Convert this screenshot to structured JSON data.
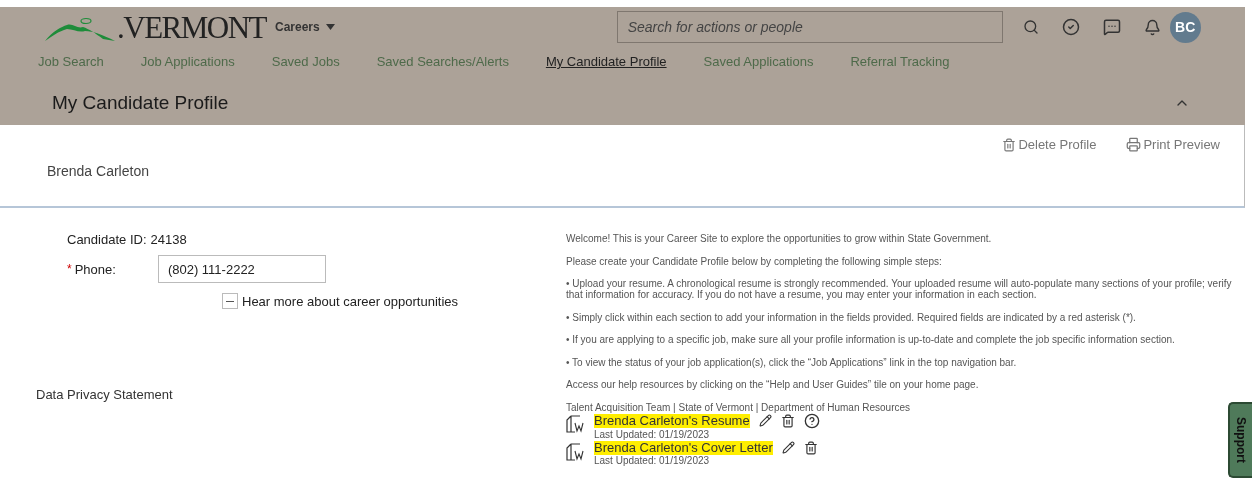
{
  "header": {
    "logo_text": ".VERMONT",
    "menu": "Careers",
    "search": {
      "placeholder": "Search for actions or people"
    },
    "avatar": "BC"
  },
  "nav": [
    {
      "label": "Job Search",
      "selected": false
    },
    {
      "label": "Job Applications",
      "selected": false
    },
    {
      "label": "Saved Jobs",
      "selected": false
    },
    {
      "label": "Saved Searches/Alerts",
      "selected": false
    },
    {
      "label": "My Candidate Profile",
      "selected": true
    },
    {
      "label": "Saved Applications",
      "selected": false
    },
    {
      "label": "Referral Tracking",
      "selected": false
    }
  ],
  "page_title": "My Candidate Profile",
  "profile": {
    "name": "Brenda Carleton",
    "actions": [
      {
        "kind": "delete",
        "label": "Delete Profile"
      },
      {
        "kind": "print",
        "label": "Print Preview"
      }
    ]
  },
  "candidate_id": {
    "label": "Candidate ID:",
    "value": "24138"
  },
  "phone": {
    "required_mark": "*",
    "label": "Phone:",
    "value": "(802) 111-2222"
  },
  "opt_in": {
    "label": "Hear more about career opportunities",
    "indeterminate": true
  },
  "privacy_link": "Data Privacy Statement",
  "welcome": [
    "Welcome! This is your Career Site to explore the opportunities to grow within State Government.",
    "Please create your Candidate Profile below by completing the following simple steps:",
    "• Upload your resume. A chronological resume is strongly recommended. Your uploaded resume will auto-populate many sections of your profile; verify that information for accuracy. If you do not have a resume, you may enter your information in each section.",
    "• Simply click within each section to add your information in the fields provided. Required fields are indicated by a red asterisk (*).",
    "• If you are applying to a specific job, make sure all your profile information is up-to-date and complete the job specific information section.",
    "• To view the status of your job application(s), click the “Job Applications” link in the top navigation bar.",
    "Access our help resources by clicking on the “Help and User Guides” tile on your home page."
  ],
  "signature": "Talent Acquisition Team | State of Vermont | Department of Human Resources",
  "documents": [
    {
      "name": "Brenda Carleton's Resume",
      "updated": "Last Updated: 01/19/2023",
      "help": true
    },
    {
      "name": "Brenda Carleton's Cover Letter",
      "updated": "Last Updated: 01/19/2023",
      "help": false
    }
  ],
  "support_tab": "Support"
}
